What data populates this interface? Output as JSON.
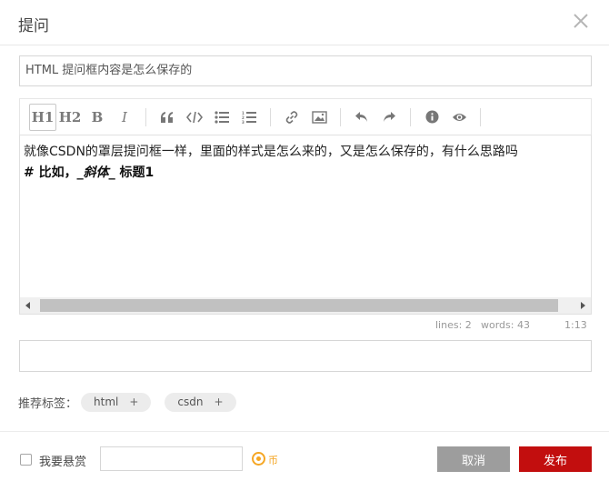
{
  "dialog": {
    "title": "提问",
    "close_icon": "close-icon"
  },
  "question_title": {
    "value": "HTML 提问框内容是怎么保存的"
  },
  "toolbar": {
    "h1": "H1",
    "h2": "H2",
    "bold": "B",
    "italic": "I",
    "icons": [
      "quote-icon",
      "code-icon",
      "unordered-list-icon",
      "ordered-list-icon",
      "link-icon",
      "image-icon",
      "undo-icon",
      "redo-icon",
      "info-icon",
      "preview-eye-icon"
    ]
  },
  "editor": {
    "line1": "就像CSDN的罩层提问框一样，里面的样式是怎么来的，又是怎么保存的，有什么思路吗",
    "line2_prefix": "# 比如，",
    "line2_italic": "_斜体_",
    "line2_suffix": " 标题1"
  },
  "status": {
    "lines": "lines: 2",
    "words": "words: 43",
    "cursor": "1:13"
  },
  "tags": {
    "label": "推荐标签：",
    "items": [
      {
        "name": "html",
        "plus": "+"
      },
      {
        "name": "csdn",
        "plus": "+"
      }
    ]
  },
  "footer": {
    "bounty_label": "我要悬赏",
    "coin_label": "币",
    "cancel": "取消",
    "publish": "发布"
  },
  "colors": {
    "publish": "#c20e0e",
    "cancel": "#9d9d9d",
    "coin": "#f5a623"
  }
}
